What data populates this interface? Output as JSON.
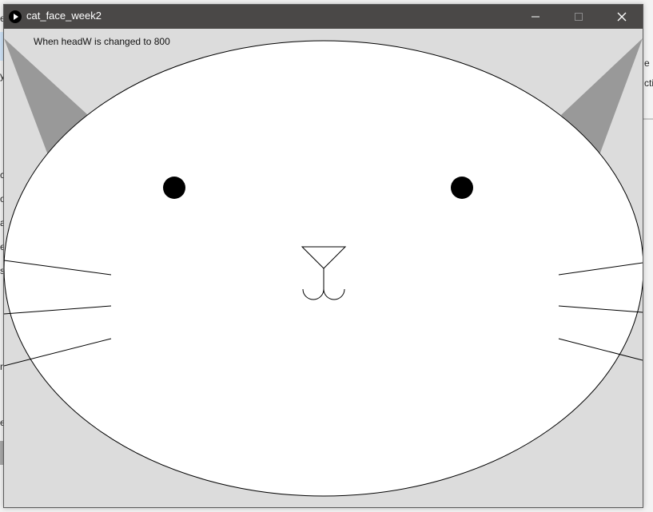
{
  "window": {
    "title": "cat_face_week2"
  },
  "sketch": {
    "caption": "When headW is changed to 800",
    "colors": {
      "background": "#dcdcdc",
      "head_fill": "#ffffff",
      "ear_fill": "#999999",
      "stroke": "#000000",
      "eye_fill": "#000000"
    }
  },
  "background_app": {
    "left_fragments": [
      "e",
      "y",
      "c",
      "o",
      "a",
      "e",
      "s",
      "n",
      "e"
    ],
    "right_fragments": [
      "e",
      "cti"
    ]
  }
}
